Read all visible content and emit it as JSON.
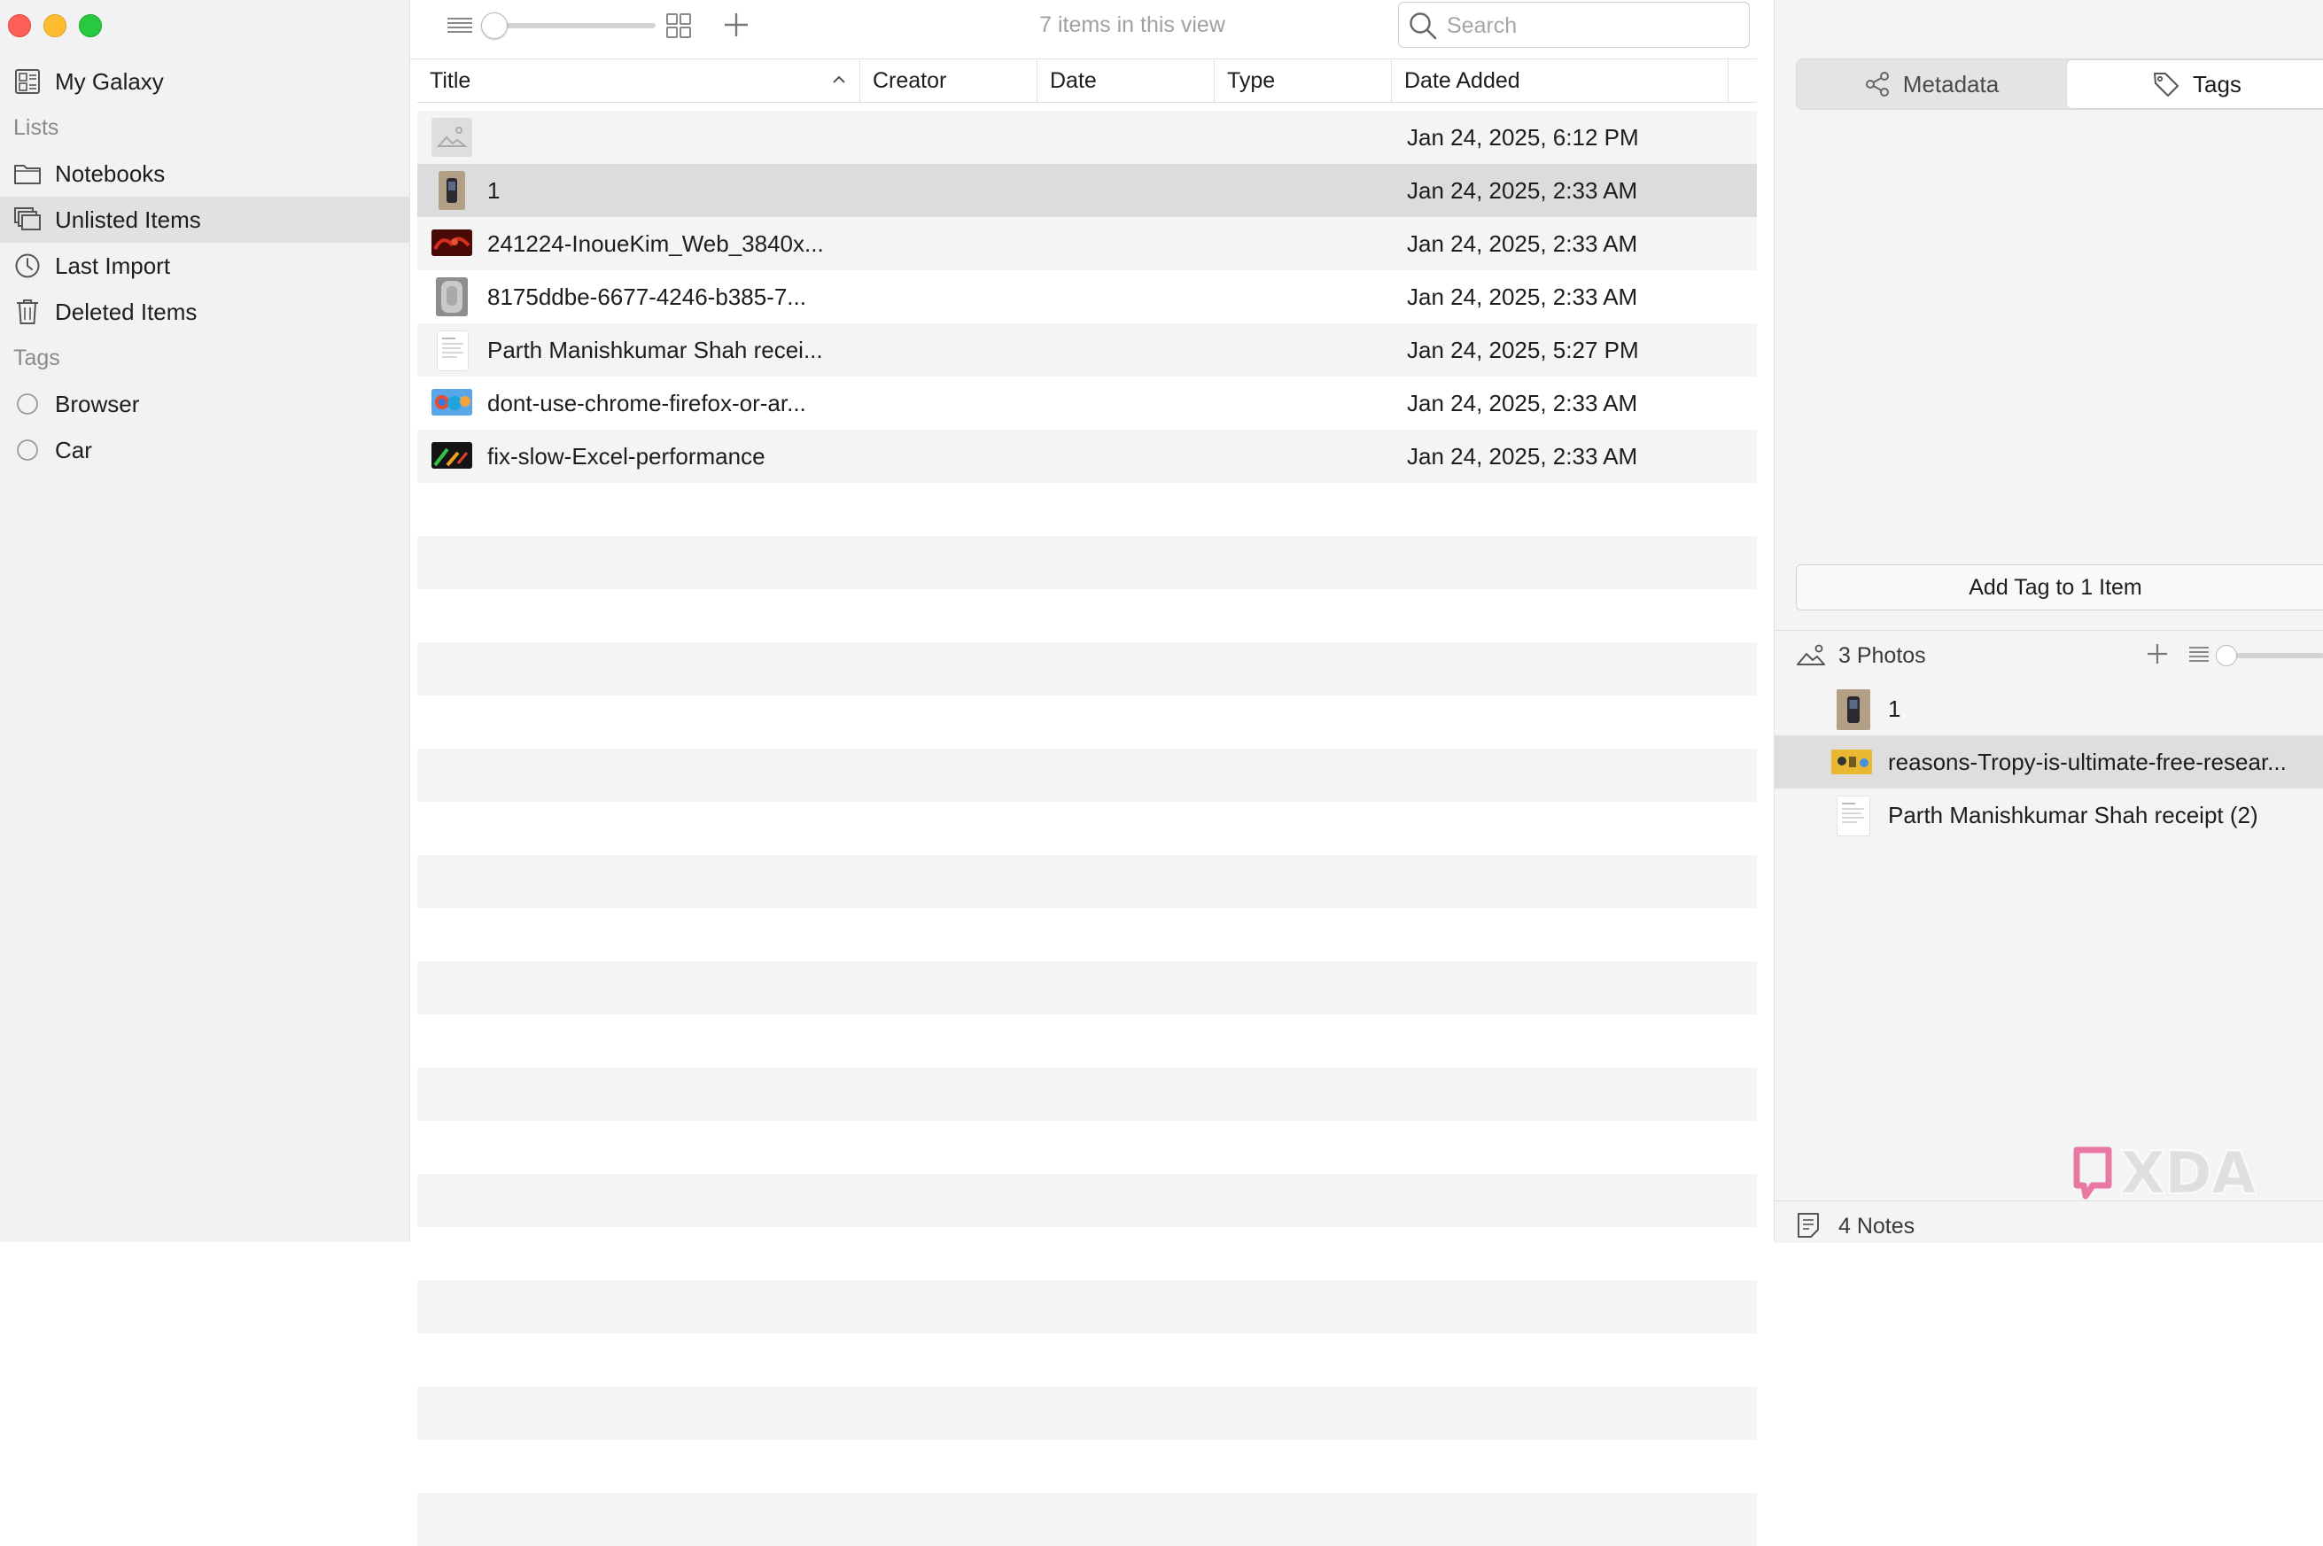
{
  "window": {
    "traffic_lights": [
      "close",
      "minimize",
      "zoom"
    ]
  },
  "sidebar": {
    "library_label": "My Galaxy",
    "lists_header": "Lists",
    "lists": [
      {
        "label": "Notebooks",
        "icon": "folder-icon"
      },
      {
        "label": "Unlisted Items",
        "icon": "stack-icon",
        "selected": true
      },
      {
        "label": "Last Import",
        "icon": "clock-icon"
      },
      {
        "label": "Deleted Items",
        "icon": "trash-icon"
      }
    ],
    "tags_header": "Tags",
    "tags": [
      {
        "label": "Browser"
      },
      {
        "label": "Car"
      }
    ]
  },
  "toolbar": {
    "item_count": "7 items in this view",
    "zoom_slider_level": 0,
    "search_placeholder": "Search"
  },
  "table": {
    "columns": [
      "Title",
      "Creator",
      "Date",
      "Type",
      "Date Added"
    ],
    "sort_column": "Title",
    "sort_direction": "ascending",
    "rows": [
      {
        "title": "",
        "date_added": "Jan 24, 2025, 6:12 PM",
        "thumb": "placeholder"
      },
      {
        "title": "1",
        "date_added": "Jan 24, 2025, 2:33 AM",
        "thumb": "device",
        "selected": true
      },
      {
        "title": "241224-InoueKim_Web_3840x...",
        "date_added": "Jan 24, 2025, 2:33 AM",
        "thumb": "red"
      },
      {
        "title": "8175ddbe-6677-4246-b385-7...",
        "date_added": "Jan 24, 2025, 2:33 AM",
        "thumb": "gray"
      },
      {
        "title": "Parth Manishkumar Shah recei...",
        "date_added": "Jan 24, 2025, 5:27 PM",
        "thumb": "document"
      },
      {
        "title": "dont-use-chrome-firefox-or-ar...",
        "date_added": "Jan 24, 2025, 2:33 AM",
        "thumb": "browser"
      },
      {
        "title": "fix-slow-Excel-performance",
        "date_added": "Jan 24, 2025, 2:33 AM",
        "thumb": "dark"
      }
    ]
  },
  "right_panel": {
    "tabs": [
      {
        "label": "Metadata",
        "icon": "share-icon"
      },
      {
        "label": "Tags",
        "icon": "tag-icon",
        "active": true
      }
    ],
    "add_tag_button": "Add Tag to 1 Item",
    "photos_title": "3 Photos",
    "photos": [
      {
        "label": "1",
        "thumb": "device"
      },
      {
        "label": "reasons-Tropy-is-ultimate-free-resear...",
        "thumb": "yellow",
        "selected": true
      },
      {
        "label": "Parth Manishkumar Shah receipt (2)",
        "thumb": "document"
      }
    ],
    "notes_title": "4 Notes"
  },
  "watermark": "XDA",
  "colors": {
    "sidebar_bg": "#f2f2f2",
    "selected_row": "#dcdcdc",
    "alt_row": "#f4f4f4",
    "traffic_red": "#ff5f57",
    "traffic_yellow": "#febc2e",
    "traffic_green": "#28c840"
  }
}
